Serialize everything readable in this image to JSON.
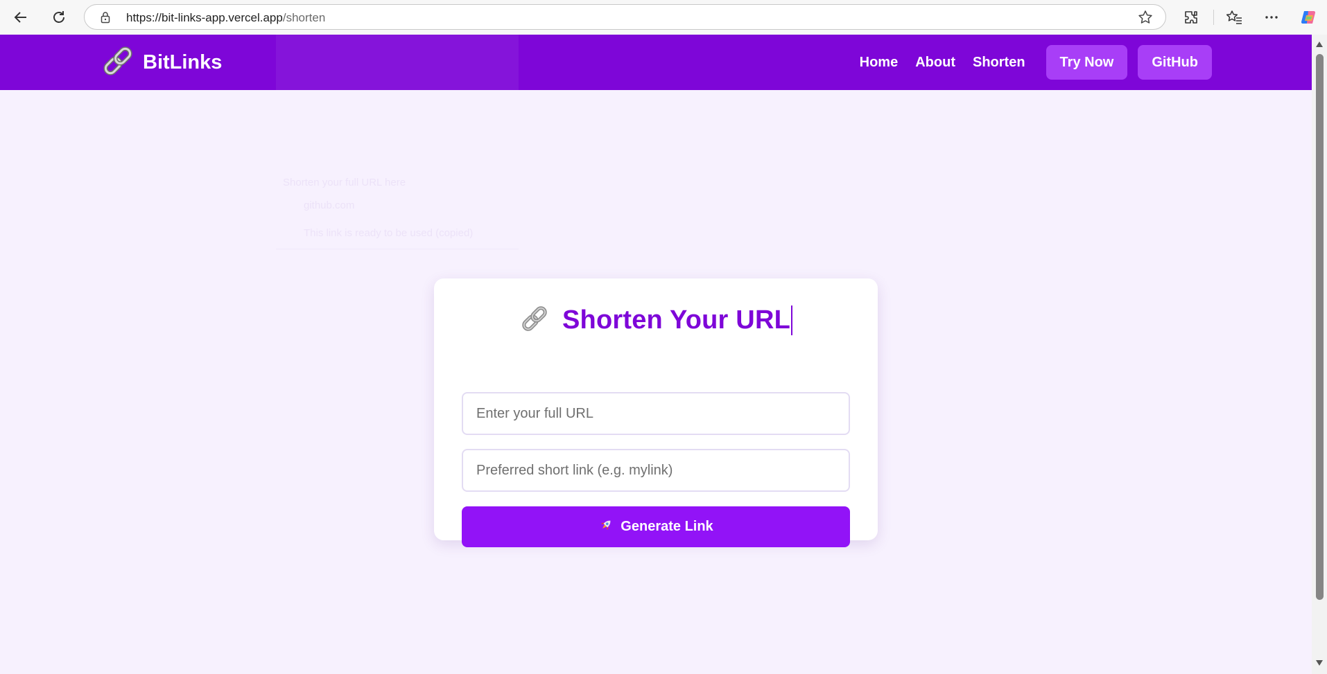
{
  "browser": {
    "url_host": "https://bit-links-app.vercel.app",
    "url_path": "/shorten",
    "icons": [
      "back-arrow-icon",
      "refresh-icon",
      "lock-icon",
      "star-icon",
      "extensions-icon",
      "favorites-icon",
      "more-icon",
      "copilot-icon"
    ]
  },
  "navbar": {
    "brand": "BitLinks",
    "links": [
      "Home",
      "About",
      "Shorten"
    ],
    "cta_try": "Try Now",
    "cta_github": "GitHub"
  },
  "ghost": {
    "heading": "Shorten your full URL here",
    "item1": "github.com",
    "item2": "This link is ready to be used (copied)"
  },
  "card": {
    "title": "Shorten Your URL",
    "url_placeholder": "Enter your full URL",
    "short_placeholder": "Preferred short link (e.g. mylink)",
    "button_label": "Generate Link"
  },
  "colors": {
    "brand_purple": "#7e06d8",
    "button_purple": "#9213f7",
    "cta_purple": "#a83ef7",
    "page_bg": "#f7f1fe"
  }
}
